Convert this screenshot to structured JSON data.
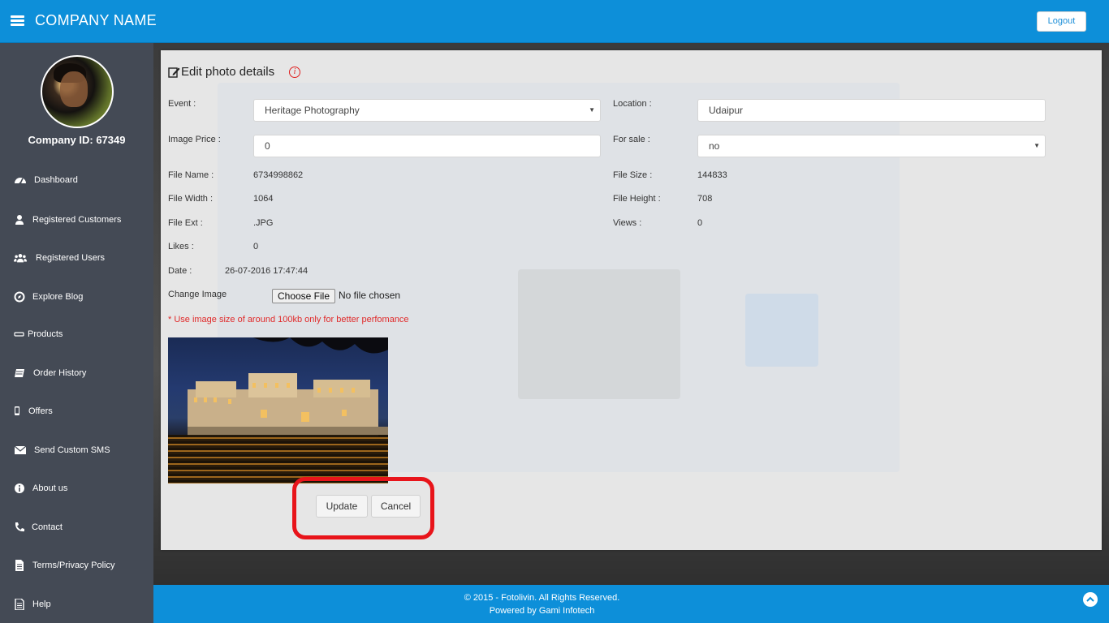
{
  "header": {
    "brand": "COMPANY NAME",
    "logout_label": "Logout"
  },
  "sidebar": {
    "company_id": "Company ID: 67349",
    "items": [
      {
        "label": "Dashboard",
        "icon": "dashboard-icon"
      },
      {
        "label": "Registered Customers",
        "icon": "user-icon"
      },
      {
        "label": "Registered Users",
        "icon": "users-icon"
      },
      {
        "label": "Explore Blog",
        "icon": "compass-icon"
      },
      {
        "label": "Products",
        "icon": "product-icon"
      },
      {
        "label": "Order History",
        "icon": "book-icon"
      },
      {
        "label": "Offers",
        "icon": "mobile-icon"
      },
      {
        "label": "Send Custom SMS",
        "icon": "envelope-icon"
      },
      {
        "label": "About us",
        "icon": "info-icon"
      },
      {
        "label": "Contact",
        "icon": "phone-icon"
      },
      {
        "label": "Terms/Privacy Policy",
        "icon": "file-icon"
      },
      {
        "label": "Help",
        "icon": "document-icon"
      }
    ]
  },
  "form": {
    "title": "Edit photo details",
    "event_label": "Event :",
    "event_value": "Heritage Photography",
    "location_label": "Location :",
    "location_value": "Udaipur",
    "price_label": "Image Price :",
    "price_value": "0",
    "for_sale_label": "For sale :",
    "for_sale_value": "no",
    "file_name_label": "File Name :",
    "file_name_value": "6734998862",
    "file_size_label": "File Size :",
    "file_size_value": "144833",
    "file_width_label": "File Width :",
    "file_width_value": "1064",
    "file_height_label": "File Height :",
    "file_height_value": "708",
    "file_ext_label": "File Ext :",
    "file_ext_value": ".JPG",
    "views_label": "Views :",
    "views_value": "0",
    "likes_label": "Likes :",
    "likes_value": "0",
    "date_label": "Date :",
    "date_value": "26-07-2016 17:47:44",
    "change_image_label": "Change Image",
    "choose_file_label": "Choose File",
    "no_file_text": "No file chosen",
    "hint": "* Use image size of around 100kb only for better perfomance",
    "update_label": "Update",
    "cancel_label": "Cancel"
  },
  "footer": {
    "copyright": "© 2015 - Fotolivin. All Rights Reserved.",
    "powered_by": "Powered by Gami Infotech"
  },
  "colors": {
    "primary": "#0d8fd9",
    "sidebar": "#444a55",
    "highlight": "#e8141a",
    "hint": "#e02a2a"
  }
}
